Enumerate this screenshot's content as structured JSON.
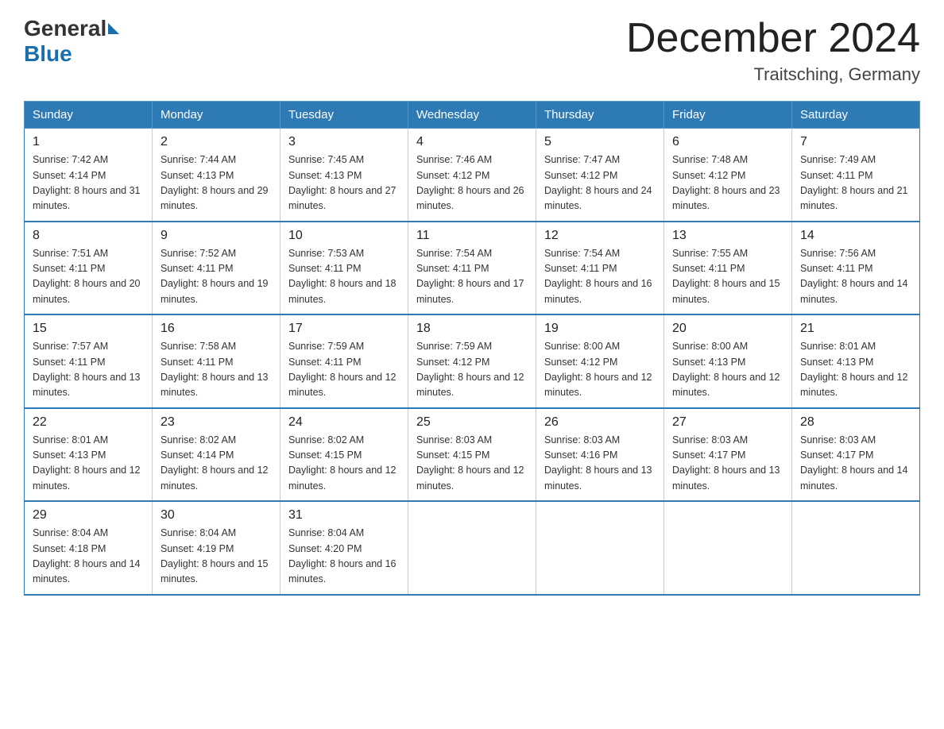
{
  "header": {
    "logo_general": "General",
    "logo_blue": "Blue",
    "month_title": "December 2024",
    "location": "Traitsching, Germany"
  },
  "weekdays": [
    "Sunday",
    "Monday",
    "Tuesday",
    "Wednesday",
    "Thursday",
    "Friday",
    "Saturday"
  ],
  "weeks": [
    [
      {
        "day": "1",
        "sunrise": "7:42 AM",
        "sunset": "4:14 PM",
        "daylight": "8 hours and 31 minutes."
      },
      {
        "day": "2",
        "sunrise": "7:44 AM",
        "sunset": "4:13 PM",
        "daylight": "8 hours and 29 minutes."
      },
      {
        "day": "3",
        "sunrise": "7:45 AM",
        "sunset": "4:13 PM",
        "daylight": "8 hours and 27 minutes."
      },
      {
        "day": "4",
        "sunrise": "7:46 AM",
        "sunset": "4:12 PM",
        "daylight": "8 hours and 26 minutes."
      },
      {
        "day": "5",
        "sunrise": "7:47 AM",
        "sunset": "4:12 PM",
        "daylight": "8 hours and 24 minutes."
      },
      {
        "day": "6",
        "sunrise": "7:48 AM",
        "sunset": "4:12 PM",
        "daylight": "8 hours and 23 minutes."
      },
      {
        "day": "7",
        "sunrise": "7:49 AM",
        "sunset": "4:11 PM",
        "daylight": "8 hours and 21 minutes."
      }
    ],
    [
      {
        "day": "8",
        "sunrise": "7:51 AM",
        "sunset": "4:11 PM",
        "daylight": "8 hours and 20 minutes."
      },
      {
        "day": "9",
        "sunrise": "7:52 AM",
        "sunset": "4:11 PM",
        "daylight": "8 hours and 19 minutes."
      },
      {
        "day": "10",
        "sunrise": "7:53 AM",
        "sunset": "4:11 PM",
        "daylight": "8 hours and 18 minutes."
      },
      {
        "day": "11",
        "sunrise": "7:54 AM",
        "sunset": "4:11 PM",
        "daylight": "8 hours and 17 minutes."
      },
      {
        "day": "12",
        "sunrise": "7:54 AM",
        "sunset": "4:11 PM",
        "daylight": "8 hours and 16 minutes."
      },
      {
        "day": "13",
        "sunrise": "7:55 AM",
        "sunset": "4:11 PM",
        "daylight": "8 hours and 15 minutes."
      },
      {
        "day": "14",
        "sunrise": "7:56 AM",
        "sunset": "4:11 PM",
        "daylight": "8 hours and 14 minutes."
      }
    ],
    [
      {
        "day": "15",
        "sunrise": "7:57 AM",
        "sunset": "4:11 PM",
        "daylight": "8 hours and 13 minutes."
      },
      {
        "day": "16",
        "sunrise": "7:58 AM",
        "sunset": "4:11 PM",
        "daylight": "8 hours and 13 minutes."
      },
      {
        "day": "17",
        "sunrise": "7:59 AM",
        "sunset": "4:11 PM",
        "daylight": "8 hours and 12 minutes."
      },
      {
        "day": "18",
        "sunrise": "7:59 AM",
        "sunset": "4:12 PM",
        "daylight": "8 hours and 12 minutes."
      },
      {
        "day": "19",
        "sunrise": "8:00 AM",
        "sunset": "4:12 PM",
        "daylight": "8 hours and 12 minutes."
      },
      {
        "day": "20",
        "sunrise": "8:00 AM",
        "sunset": "4:13 PM",
        "daylight": "8 hours and 12 minutes."
      },
      {
        "day": "21",
        "sunrise": "8:01 AM",
        "sunset": "4:13 PM",
        "daylight": "8 hours and 12 minutes."
      }
    ],
    [
      {
        "day": "22",
        "sunrise": "8:01 AM",
        "sunset": "4:13 PM",
        "daylight": "8 hours and 12 minutes."
      },
      {
        "day": "23",
        "sunrise": "8:02 AM",
        "sunset": "4:14 PM",
        "daylight": "8 hours and 12 minutes."
      },
      {
        "day": "24",
        "sunrise": "8:02 AM",
        "sunset": "4:15 PM",
        "daylight": "8 hours and 12 minutes."
      },
      {
        "day": "25",
        "sunrise": "8:03 AM",
        "sunset": "4:15 PM",
        "daylight": "8 hours and 12 minutes."
      },
      {
        "day": "26",
        "sunrise": "8:03 AM",
        "sunset": "4:16 PM",
        "daylight": "8 hours and 13 minutes."
      },
      {
        "day": "27",
        "sunrise": "8:03 AM",
        "sunset": "4:17 PM",
        "daylight": "8 hours and 13 minutes."
      },
      {
        "day": "28",
        "sunrise": "8:03 AM",
        "sunset": "4:17 PM",
        "daylight": "8 hours and 14 minutes."
      }
    ],
    [
      {
        "day": "29",
        "sunrise": "8:04 AM",
        "sunset": "4:18 PM",
        "daylight": "8 hours and 14 minutes."
      },
      {
        "day": "30",
        "sunrise": "8:04 AM",
        "sunset": "4:19 PM",
        "daylight": "8 hours and 15 minutes."
      },
      {
        "day": "31",
        "sunrise": "8:04 AM",
        "sunset": "4:20 PM",
        "daylight": "8 hours and 16 minutes."
      },
      null,
      null,
      null,
      null
    ]
  ]
}
